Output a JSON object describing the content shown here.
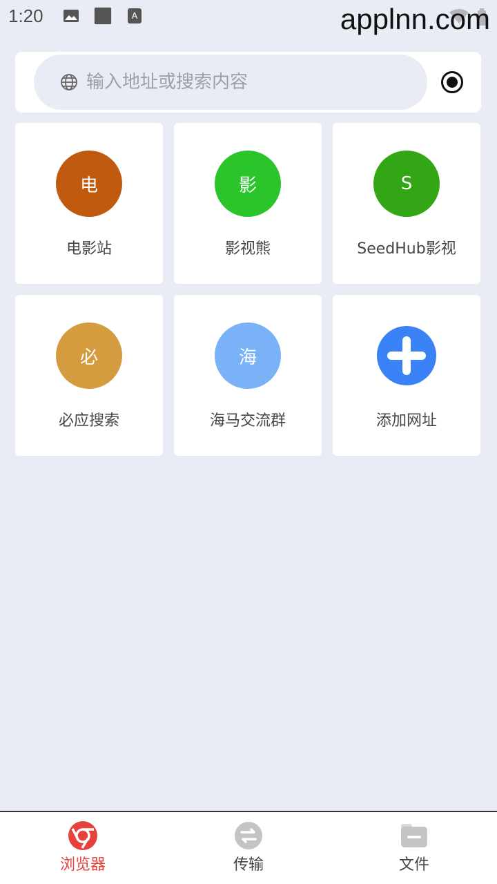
{
  "status_bar": {
    "time": "1:20",
    "icons": [
      "image-icon",
      "square-icon",
      "accessibility-text-icon"
    ],
    "watermark": "applnn.com"
  },
  "search": {
    "placeholder": "输入地址或搜索内容",
    "value": ""
  },
  "shortcuts": [
    {
      "glyph": "电",
      "label": "电影站",
      "color": "#c05a0f"
    },
    {
      "glyph": "影",
      "label": "影视熊",
      "color": "#2bc52b"
    },
    {
      "glyph": "S",
      "label": "SeedHub影视",
      "color": "#33a615"
    },
    {
      "glyph": "必",
      "label": "必应搜索",
      "color": "#d49b3f"
    },
    {
      "glyph": "海",
      "label": "海马交流群",
      "color": "#7ab2f7"
    },
    {
      "glyph": "+",
      "label": "添加网址",
      "color": "#3b82f6"
    }
  ],
  "nav": {
    "browser": "浏览器",
    "transfer": "传输",
    "files": "文件"
  },
  "colors": {
    "accent": "#e5423b",
    "background": "#e9ecf4"
  }
}
